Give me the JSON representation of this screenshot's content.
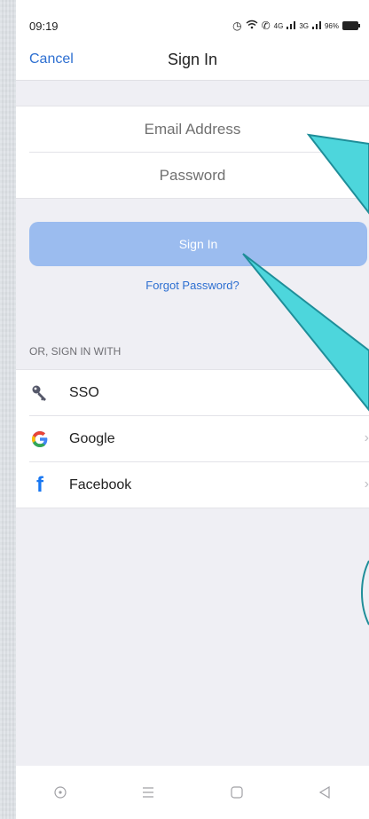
{
  "status_bar": {
    "time": "09:19",
    "network_1": "4G",
    "network_2": "3G",
    "battery": "96%"
  },
  "nav": {
    "cancel_label": "Cancel",
    "title": "Sign In"
  },
  "form": {
    "email_placeholder": "Email Address",
    "email_value": "",
    "password_placeholder": "Password",
    "password_value": ""
  },
  "signin_button_label": "Sign In",
  "forgot_password_label": "Forgot Password?",
  "alt_signin": {
    "header": "OR, SIGN IN WITH",
    "providers": [
      {
        "label": "SSO",
        "icon": "key-icon"
      },
      {
        "label": "Google",
        "icon": "google-icon",
        "color": "#4285f4"
      },
      {
        "label": "Facebook",
        "icon": "facebook-icon",
        "color": "#1877f2"
      }
    ]
  },
  "colors": {
    "accent": "#2d6fd1",
    "button_disabled": "#9bbcef",
    "annotation_arrow": "#4dd6dc"
  }
}
